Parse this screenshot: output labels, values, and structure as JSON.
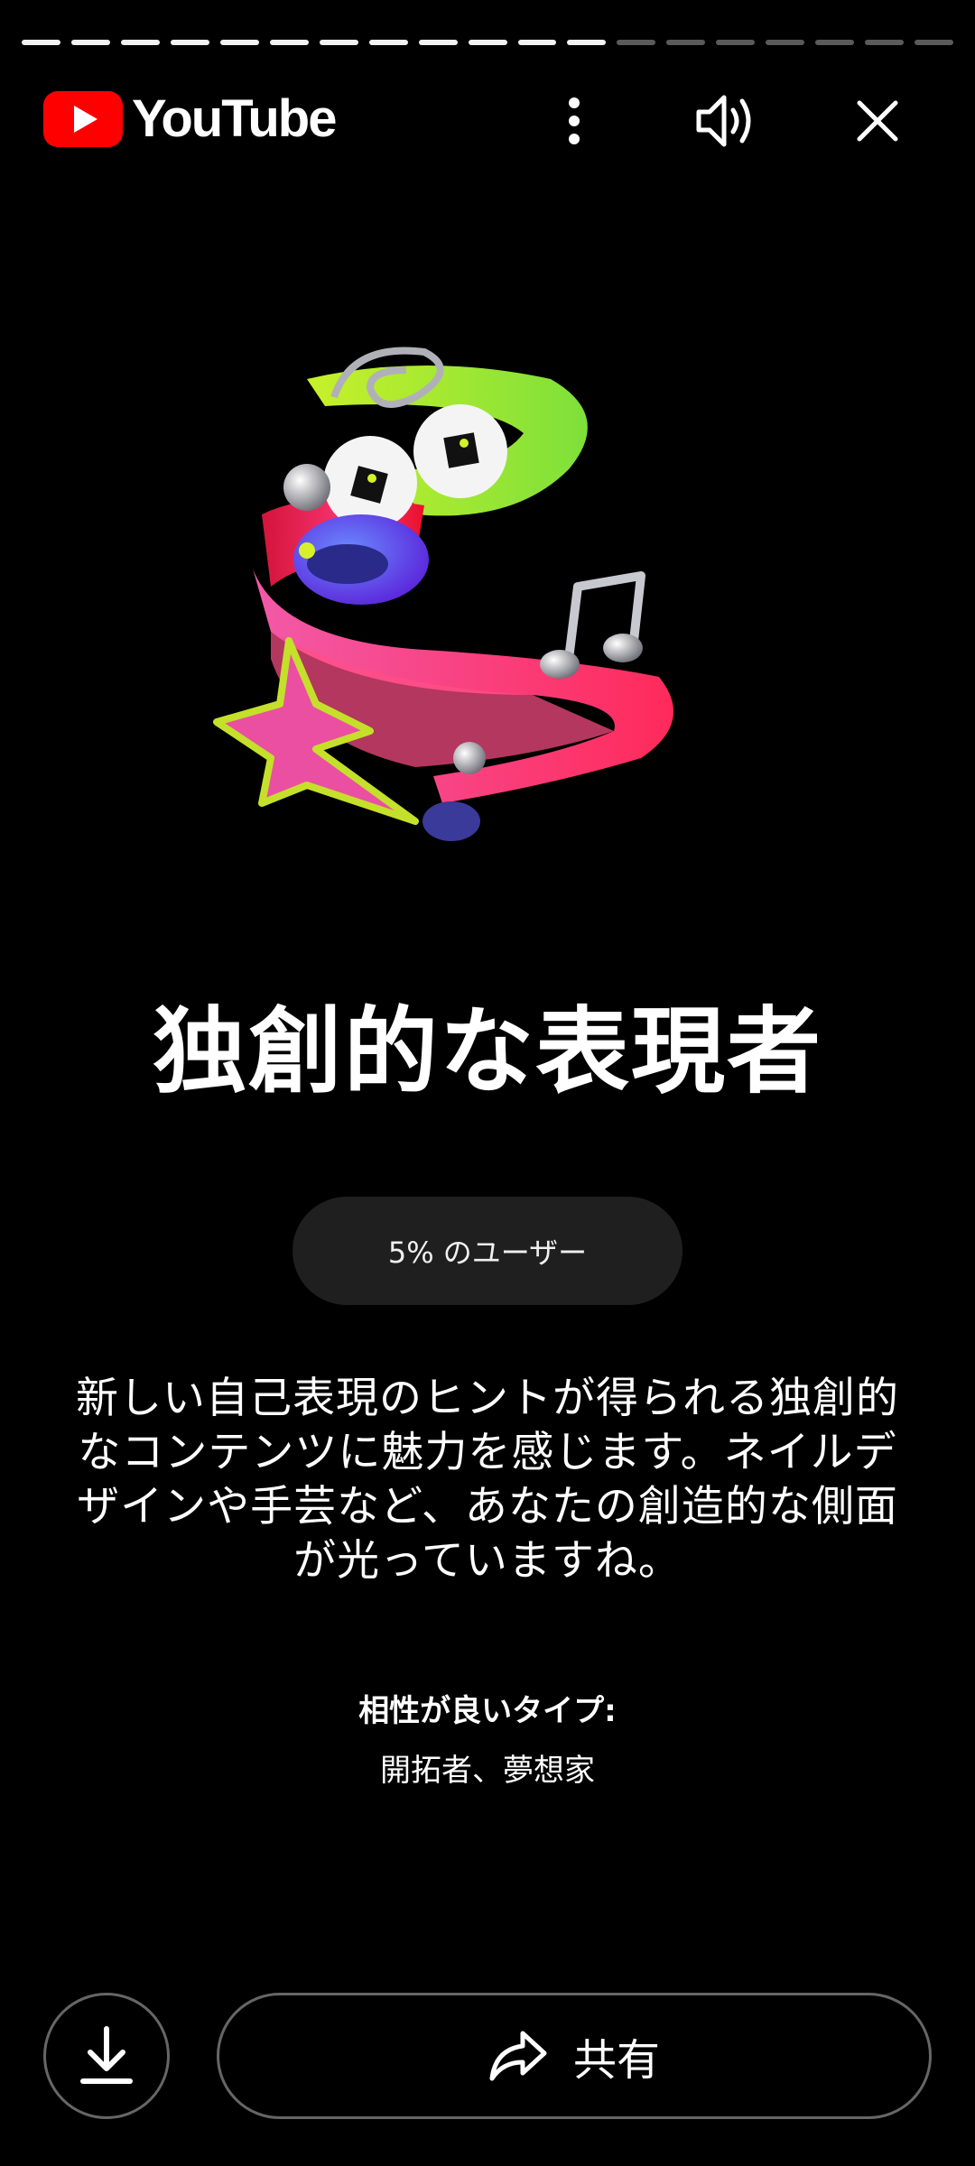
{
  "progress": {
    "segments_total": 19,
    "segments_complete": 12
  },
  "header": {
    "logo_text": "YouTube",
    "icons": [
      "more-vert-icon",
      "volume-icon",
      "close-icon"
    ]
  },
  "card": {
    "title": "独創的な表現者",
    "percent_badge": "5% のユーザー",
    "description": "新しい自己表現のヒントが得られる独創的なコンテンツに魅力を感じます。ネイルデザインや手芸など、あなたの創造的な側面が光っていますね。",
    "compatible_label": "相性が良いタイプ:",
    "compatible_types": "開拓者、夢想家"
  },
  "actions": {
    "download_icon": "download-icon",
    "share_label": "共有",
    "share_icon": "share-arrow-icon"
  },
  "colors": {
    "background": "#000000",
    "brand_red": "#ff0000",
    "pill_bg": "#1f1f1f"
  }
}
